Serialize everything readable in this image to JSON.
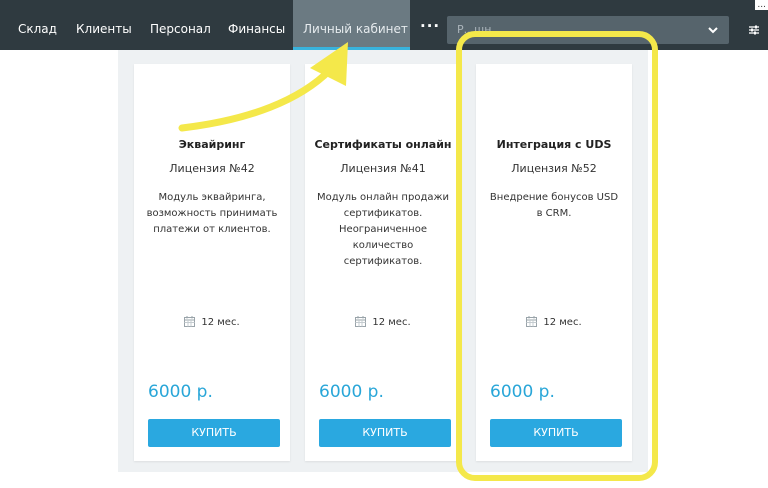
{
  "nav": {
    "tabs": [
      {
        "label": "Склад"
      },
      {
        "label": "Клиенты"
      },
      {
        "label": "Персонал"
      },
      {
        "label": "Финансы"
      },
      {
        "label": "Личный кабинет",
        "active": true
      }
    ],
    "more_label": "...",
    "select_value": "Р...шн.. ..... . ....",
    "topright_text": "..."
  },
  "cards": [
    {
      "title": "Эквайринг",
      "license": "Лицензия №42",
      "description": "Модуль эквайринга, возможность принимать платежи от клиентов.",
      "term": "12 мес.",
      "price": "6000 р.",
      "button": "КУПИТЬ"
    },
    {
      "title": "Сертификаты онлайн",
      "license": "Лицензия №41",
      "description": "Модуль онлайн продажи сертификатов. Неограниченное количество сертификатов.",
      "term": "12 мес.",
      "price": "6000 р.",
      "button": "КУПИТЬ"
    },
    {
      "title": "Интеграция с UDS",
      "license": "Лицензия №52",
      "description": "Внедрение бонусов USD в CRM.",
      "term": "12 мес.",
      "price": "6000 р.",
      "button": "КУПИТЬ"
    }
  ],
  "colors": {
    "topbar": "#2f3a40",
    "active_tab": "#6b7a82",
    "accent": "#2aa8e0",
    "price": "#29a6d8",
    "highlight": "#f4e84a"
  },
  "icons": {
    "calendar": "calendar-icon",
    "chevron": "chevron-down-icon",
    "settings": "settings-sliders-icon",
    "more": "more-dots-icon"
  }
}
